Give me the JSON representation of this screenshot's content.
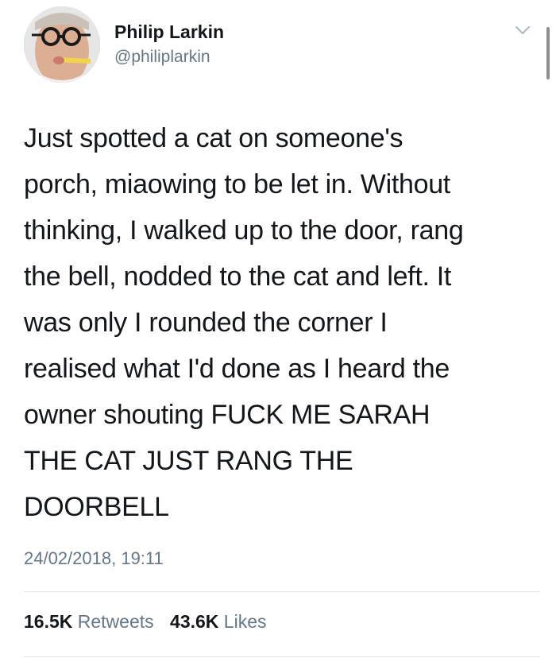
{
  "tweet": {
    "author": {
      "display_name": "Philip Larkin",
      "handle": "@philiplarkin",
      "avatar_icon": "profile-photo"
    },
    "menu_icon": "chevron-down-icon",
    "text_lines": [
      "Just spotted a cat on someone's",
      "porch, miaowing to be let in. Without",
      "thinking, I walked up to the door, rang",
      "the bell, nodded to the cat and left. It",
      "was only I rounded the corner I",
      "realised what I'd done as I heard the",
      "owner shouting FUCK ME SARAH",
      "THE CAT JUST RANG THE",
      "DOORBELL"
    ],
    "timestamp": "24/02/2018, 19:11",
    "stats": {
      "retweets_count": "16.5K",
      "retweets_label": "Retweets",
      "likes_count": "43.6K",
      "likes_label": "Likes"
    }
  },
  "colors": {
    "text": "#14171a",
    "secondary": "#657786",
    "divider": "#e1e8ed"
  }
}
